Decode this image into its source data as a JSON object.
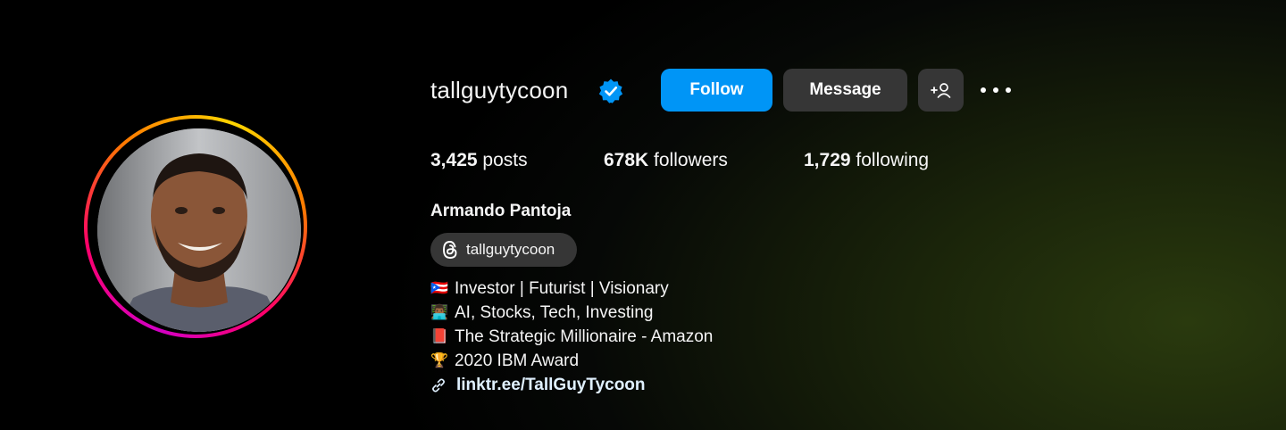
{
  "profile": {
    "username": "tallguytycoon",
    "verified": true,
    "full_name": "Armando Pantoja",
    "avatar_alt": "profile-photo"
  },
  "actions": {
    "follow_label": "Follow",
    "message_label": "Message",
    "add_label": "+👤",
    "more_icon": "more-horizontal-icon"
  },
  "stats": {
    "posts_count": "3,425",
    "posts_label": " posts",
    "followers_count": "678K",
    "followers_label": " followers",
    "following_count": "1,729",
    "following_label": " following"
  },
  "threads": {
    "handle": "tallguytycoon",
    "icon": "threads-icon"
  },
  "bio": {
    "lines": [
      {
        "icon": "🇵🇷",
        "text": "Investor | Futurist | Visionary"
      },
      {
        "icon": "👨🏾‍💻",
        "text": "AI, Stocks, Tech, Investing"
      },
      {
        "icon": "📕",
        "text": "The Strategic Millionaire - Amazon"
      },
      {
        "icon": "🏆",
        "text": "2020 IBM Award"
      }
    ],
    "link": "linktr.ee/TallGuyTycoon",
    "link_icon": "link-icon"
  },
  "colors": {
    "accent_blue": "#0095f6",
    "verified_blue": "#0095f6",
    "button_gray": "#363636",
    "link_text": "#e0f1ff"
  }
}
